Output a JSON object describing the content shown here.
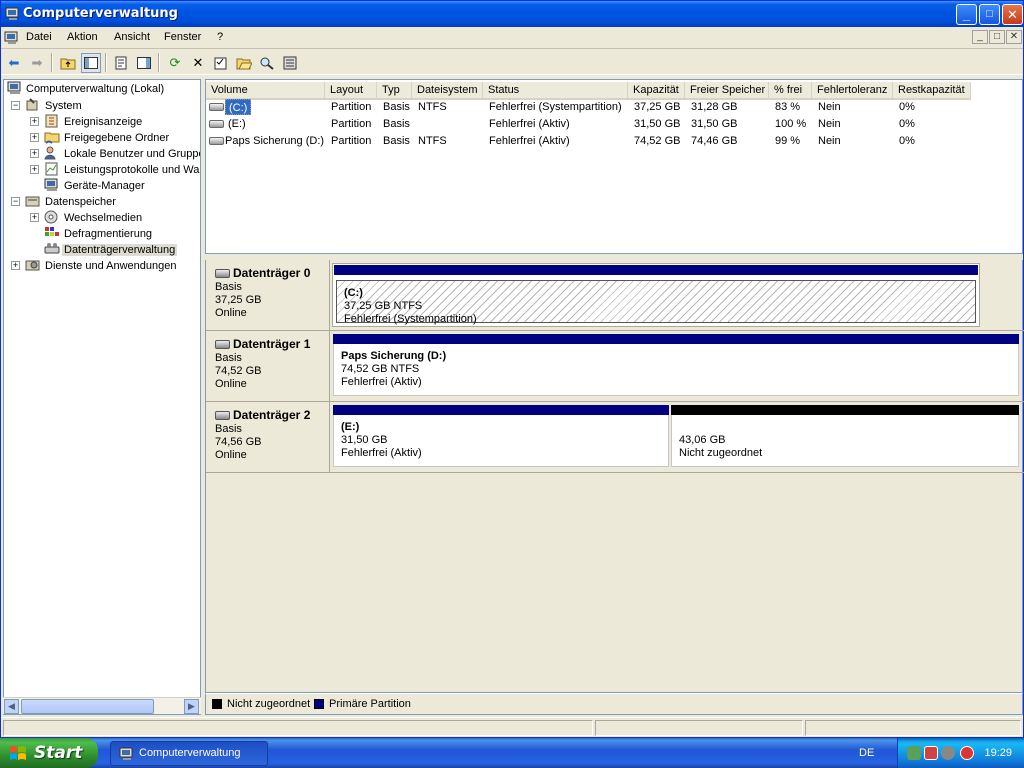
{
  "window": {
    "title": "Computerverwaltung",
    "controls": {
      "minimize": "_",
      "maximize": "□",
      "close": "✕"
    }
  },
  "menu": {
    "items": [
      "Datei",
      "Aktion",
      "Ansicht",
      "Fenster",
      "?"
    ]
  },
  "tree": {
    "root": "Computerverwaltung (Lokal)",
    "system": "System",
    "system_children": [
      "Ereignisanzeige",
      "Freigegebene Ordner",
      "Lokale Benutzer und Gruppe",
      "Leistungsprotokolle und War",
      "Geräte-Manager"
    ],
    "storage": "Datenspeicher",
    "storage_children": [
      "Wechselmedien",
      "Defragmentierung",
      "Datenträgerverwaltung"
    ],
    "services": "Dienste und Anwendungen",
    "expander_plus": "+",
    "expander_minus": "−"
  },
  "volumes": {
    "headers": [
      "Volume",
      "Layout",
      "Typ",
      "Dateisystem",
      "Status",
      "Kapazität",
      "Freier Speicher",
      "% frei",
      "Fehlertoleranz",
      "Restkapazität"
    ],
    "rows": [
      [
        "(C:)",
        "Partition",
        "Basis",
        "NTFS",
        "Fehlerfrei (Systempartition)",
        "37,25 GB",
        "31,28 GB",
        "83 %",
        "Nein",
        "0%"
      ],
      [
        "(E:)",
        "Partition",
        "Basis",
        "",
        "Fehlerfrei (Aktiv)",
        "31,50 GB",
        "31,50 GB",
        "100 %",
        "Nein",
        "0%"
      ],
      [
        "Paps Sicherung (D:)",
        "Partition",
        "Basis",
        "NTFS",
        "Fehlerfrei (Aktiv)",
        "74,52 GB",
        "74,46 GB",
        "99 %",
        "Nein",
        "0%"
      ]
    ]
  },
  "disks": [
    {
      "title": "Datenträger 0",
      "type": "Basis",
      "size": "37,25 GB",
      "state": "Online",
      "partitions": [
        {
          "name": "(C:)",
          "detail": "37,25 GB NTFS",
          "status": "Fehlerfrei (Systempartition)"
        }
      ]
    },
    {
      "title": "Datenträger 1",
      "type": "Basis",
      "size": "74,52 GB",
      "state": "Online",
      "partitions": [
        {
          "name": "Paps Sicherung  (D:)",
          "detail": "74,52 GB NTFS",
          "status": "Fehlerfrei (Aktiv)"
        }
      ]
    },
    {
      "title": "Datenträger 2",
      "type": "Basis",
      "size": "74,56 GB",
      "state": "Online",
      "partitions": [
        {
          "name": "(E:)",
          "detail": "31,50 GB",
          "status": "Fehlerfrei (Aktiv)"
        },
        {
          "name": "",
          "detail": "43,06 GB",
          "status": "Nicht zugeordnet"
        }
      ]
    }
  ],
  "legend": {
    "unallocated": "Nicht zugeordnet",
    "primary": "Primäre Partition",
    "colors": {
      "unallocated": "#000000",
      "primary": "#000080"
    }
  },
  "taskbar": {
    "start": "Start",
    "task": "Computerverwaltung",
    "language": "DE",
    "clock": "19:29"
  }
}
